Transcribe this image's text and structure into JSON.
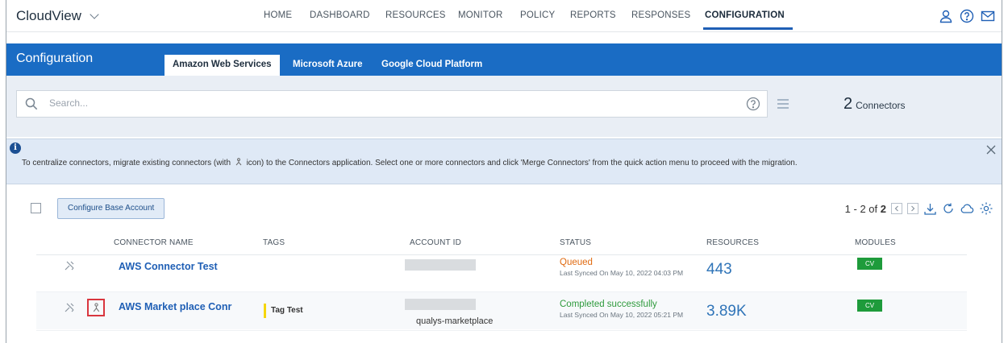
{
  "brand": {
    "title": "CloudView"
  },
  "nav": {
    "items": [
      {
        "label": "HOME"
      },
      {
        "label": "DASHBOARD"
      },
      {
        "label": "RESOURCES"
      },
      {
        "label": "MONITOR"
      },
      {
        "label": "POLICY"
      },
      {
        "label": "REPORTS"
      },
      {
        "label": "RESPONSES"
      },
      {
        "label": "CONFIGURATION"
      }
    ],
    "active": "CONFIGURATION"
  },
  "header": {
    "title": "Configuration",
    "tabs": [
      {
        "label": "Amazon Web Services"
      },
      {
        "label": "Microsoft Azure"
      },
      {
        "label": "Google Cloud Platform"
      }
    ]
  },
  "search": {
    "placeholder": "Search..."
  },
  "summary": {
    "count": "2",
    "label": "Connectors"
  },
  "banner": {
    "message_part1": "To centralize connectors, migrate existing connectors (with",
    "message_part2": "icon) to the Connectors application. Select one or more connectors and click 'Merge Connectors' from the quick action menu to proceed with the migration."
  },
  "toolbar": {
    "configure_label": "Configure Base Account",
    "pager_range": "1 - 2 of",
    "pager_total": "2"
  },
  "table": {
    "columns": [
      "CONNECTOR NAME",
      "TAGS",
      "ACCOUNT ID",
      "STATUS",
      "RESOURCES",
      "MODULES"
    ],
    "rows": [
      {
        "name": "AWS Connector Test",
        "tag": "",
        "account_text": "",
        "status": "Queued",
        "status_color": "#e06a10",
        "synced": "Last Synced On May 10, 2022 04:03 PM",
        "resources": "443",
        "module": "CV"
      },
      {
        "name": "AWS Market place Conr",
        "tag": "Tag Test",
        "account_text": "qualys-marketplace",
        "status": "Completed successfully",
        "status_color": "#2e9a3c",
        "synced": "Last Synced On May 10, 2022 05:21 PM",
        "resources": "3.89K",
        "module": "CV"
      }
    ]
  },
  "colors": {
    "accent": "#1a6cc4",
    "badge": "#1e9b3b",
    "highlight": "#d9363e"
  }
}
